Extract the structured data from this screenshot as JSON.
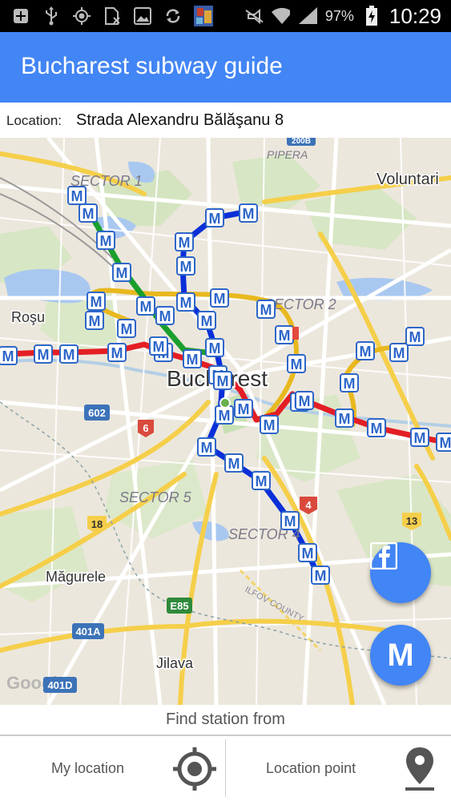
{
  "status_bar": {
    "battery_percent": "97%",
    "time": "10:29",
    "icons": [
      "add-icon",
      "usb-icon",
      "gps-icon",
      "sim-off-icon",
      "image-icon",
      "sync-icon",
      "app-thumbnail-icon",
      "mute-icon",
      "wifi-icon",
      "signal-icon",
      "battery-charging-icon"
    ]
  },
  "app_bar": {
    "title": "Bucharest subway guide"
  },
  "location_bar": {
    "label": "Location:",
    "value": "Strada Alexandru Bălăşanu 8"
  },
  "map": {
    "labels": {
      "city": "Bucharest",
      "sector1": "SECTOR 1",
      "sector2": "SECTOR 2",
      "sector4": "SECTOR 4",
      "sector5": "SECTOR 5",
      "voluntari": "Voluntari",
      "pipera": "PIPERA",
      "rosu": "Roşu",
      "magurele": "Măgurele",
      "jilava": "Jilava",
      "ilfov": "ILFOV COUNTY",
      "road_602": "602",
      "road_6": "6",
      "road_18": "18",
      "road_4": "4",
      "road_13": "13",
      "road_e85": "E85",
      "road_401a": "401A",
      "road_401d": "401D",
      "road_200b": "200B",
      "google": "Google",
      "station_marker": "M"
    },
    "line_colors": {
      "m1": "#e31e24",
      "m2": "#0a2fd8",
      "m3": "#e31e24",
      "m4": "#1a9f2d",
      "ring": "#f3c21b"
    },
    "facebook_button": "f",
    "metro_button": "M"
  },
  "find_station": {
    "label": "Find station from"
  },
  "bottom_actions": {
    "my_location": "My location",
    "location_point": "Location point"
  }
}
